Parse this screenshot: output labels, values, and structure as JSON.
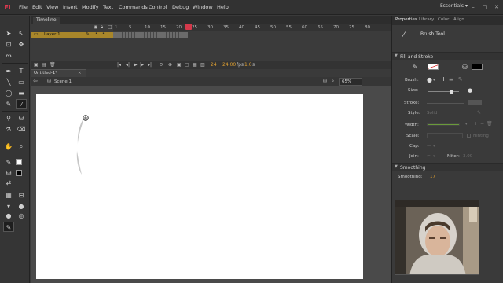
{
  "app": {
    "logo_text": "Fl"
  },
  "menu": [
    "File",
    "Edit",
    "View",
    "Insert",
    "Modify",
    "Text",
    "Commands",
    "Control",
    "Debug",
    "Window",
    "Help"
  ],
  "workspace": {
    "label": "Essentials",
    "chevron": "▾"
  },
  "window_controls": {
    "minimize": "–",
    "maximize": "□",
    "close": "✕"
  },
  "timeline": {
    "tab_label": "Timeline",
    "frame_numbers": [
      "1",
      "5",
      "10",
      "15",
      "20",
      "25",
      "30",
      "35",
      "40",
      "45",
      "50",
      "55",
      "60",
      "65",
      "70",
      "75",
      "80"
    ],
    "layer_name": "Layer 1",
    "current_frame": "24",
    "frame_rate": "24.00",
    "fps_label": "fps",
    "elapsed_time": "1.0",
    "time_unit": "s"
  },
  "document": {
    "tab_label": "Untitled-1*",
    "close": "×",
    "scene": "Scene 1",
    "zoom": "65%",
    "back_arrow": "⇦"
  },
  "properties": {
    "tabs": [
      "Properties",
      "Library",
      "Color",
      "Align"
    ],
    "tool_name": "Brush Tool",
    "sections": {
      "fill_stroke": "Fill and Stroke",
      "smoothing": "Smoothing"
    },
    "labels": {
      "brush": "Brush:",
      "size": "Size:",
      "stroke": "Stroke:",
      "style": "Style:",
      "style_value": "Solid",
      "width": "Width:",
      "scale": "Scale:",
      "hinting": "Hinting",
      "cap": "Cap:",
      "join": "Join:",
      "miter": "Miter:",
      "miter_value": "3.00",
      "smoothing": "Smoothing:",
      "smoothing_value": "17"
    },
    "fill_color": "#000000",
    "accent_color": "#e0a030"
  },
  "colors": {
    "menubar": "#323232",
    "panel": "#3a3a3a",
    "layer_highlight": "#a8862a",
    "playhead": "#d4394b",
    "stage": "#ffffff"
  }
}
